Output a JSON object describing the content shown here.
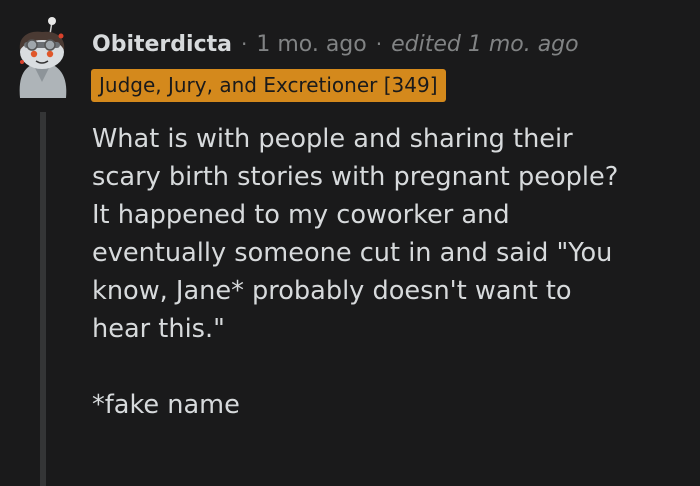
{
  "comment": {
    "avatar": {
      "icon": "snoo-avatar-icon"
    },
    "author": "Obiterdicta",
    "separator": "·",
    "time_ago": "1 mo. ago",
    "edited_label": "edited 1 mo. ago",
    "flair": {
      "text": "Judge, Jury, and Excretioner [349]",
      "background": "#d4891c"
    },
    "body": {
      "paragraph_1": "What is with people and sharing their\nscary birth stories with pregnant people?\nIt happened to my coworker and\neventually someone cut in and said \"You\nknow, Jane* probably doesn't want to\nhear this.\"",
      "paragraph_2": "*fake name"
    }
  },
  "colors": {
    "background": "#1a1a1b",
    "text": "#d7dadc",
    "meta_text": "#818384",
    "thread_line": "#343536"
  }
}
